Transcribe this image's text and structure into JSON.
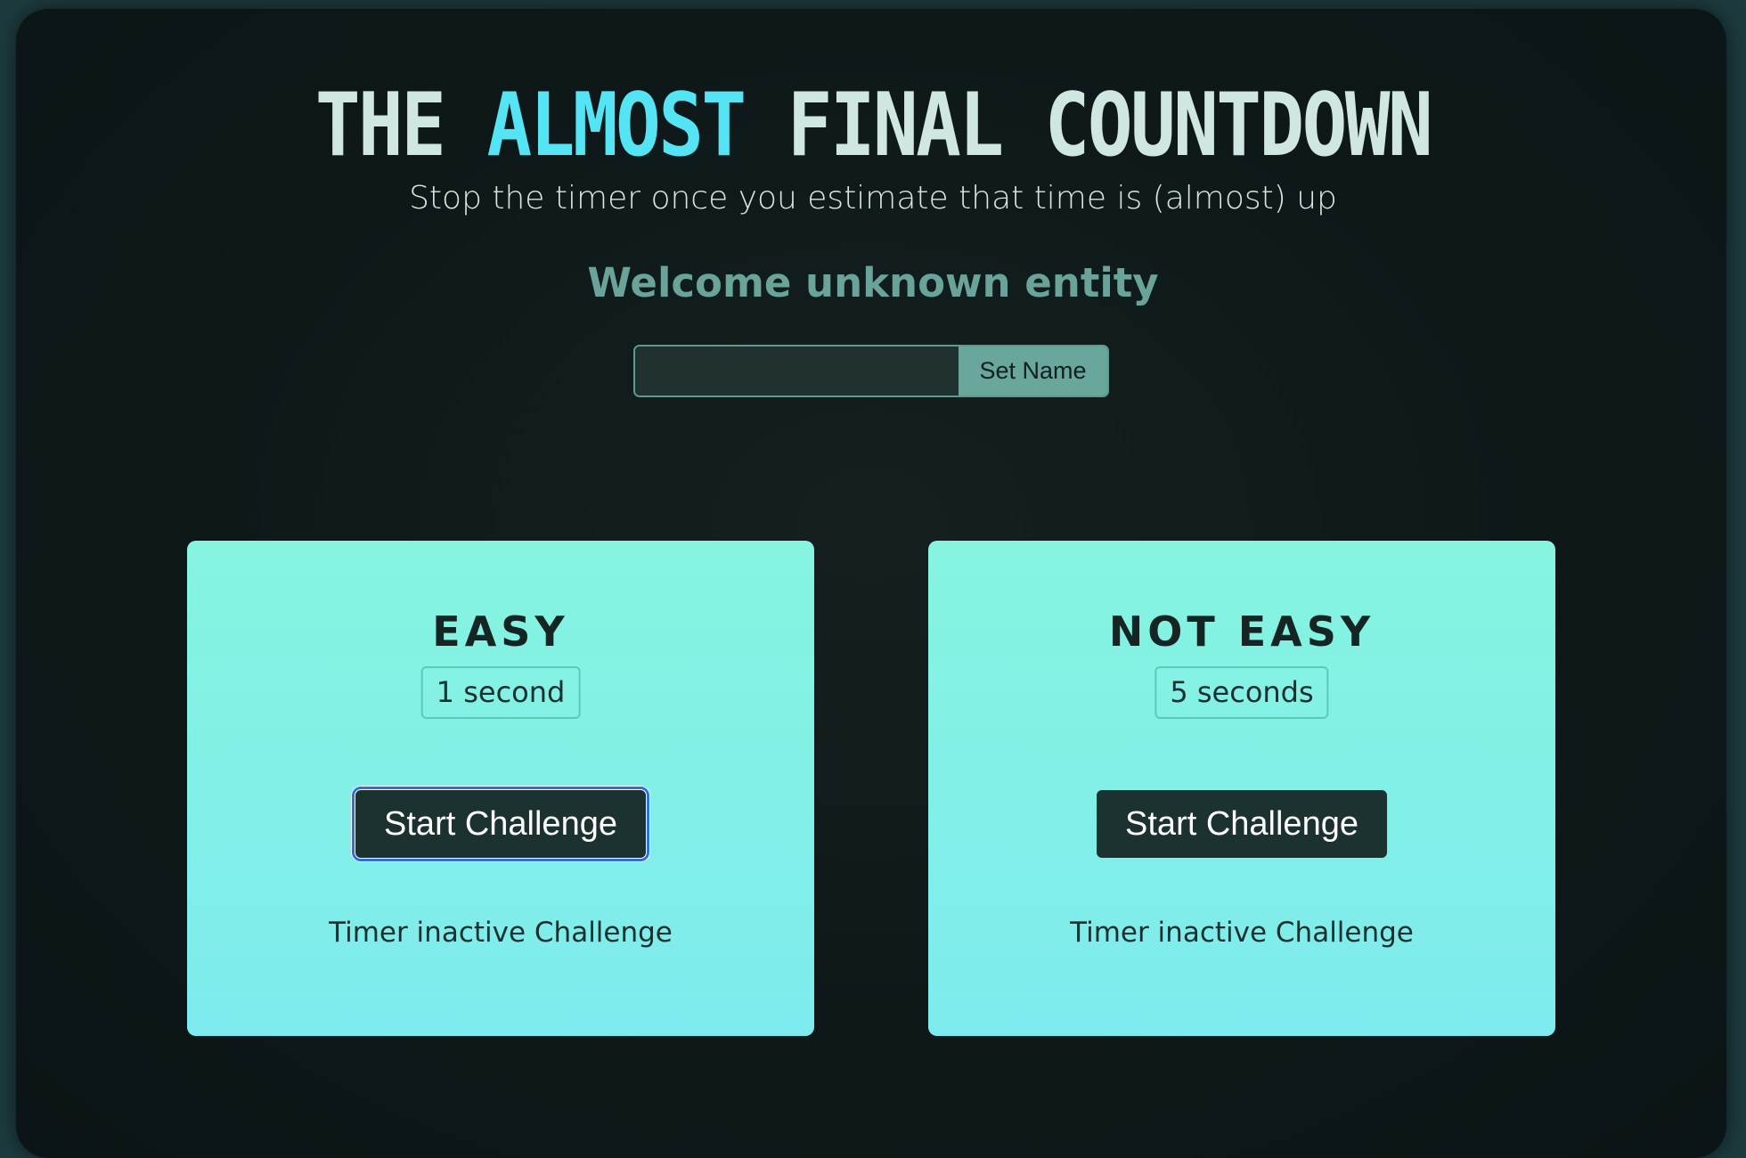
{
  "header": {
    "title_before": "THE",
    "title_accent": "ALMOST",
    "title_after": "FINAL COUNTDOWN",
    "subtitle": "Stop the timer once you estimate that time is (almost) up"
  },
  "welcome": {
    "text": "Welcome unknown entity"
  },
  "name_form": {
    "input_value": "",
    "button_label": "Set Name"
  },
  "challenges": [
    {
      "title": "EASY",
      "duration": "1 second",
      "button_label": "Start Challenge",
      "status": "Timer inactive Challenge",
      "focused": true
    },
    {
      "title": "NOT EASY",
      "duration": "5 seconds",
      "button_label": "Start Challenge",
      "status": "Timer inactive Challenge",
      "focused": false
    }
  ],
  "colors": {
    "accent": "#55e4f4",
    "background": "#0e1819",
    "card_top": "#86f4e0",
    "card_bottom": "#7eebee",
    "button_dark": "#1b3231",
    "welcome_text": "#6aa399"
  }
}
